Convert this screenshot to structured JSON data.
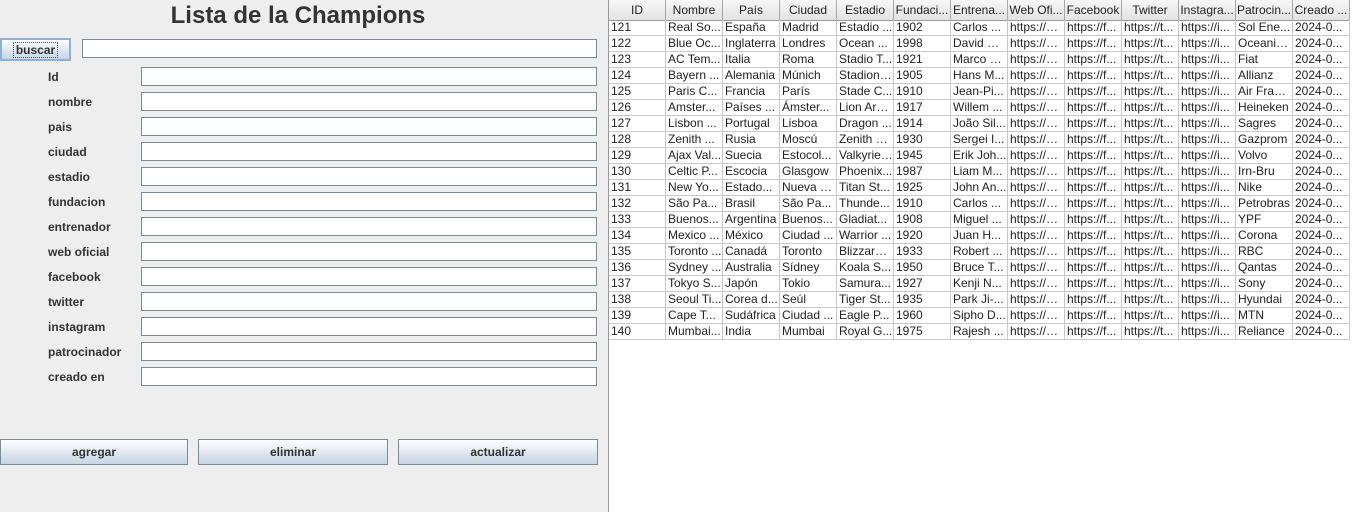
{
  "title": "Lista de la Champions",
  "search": {
    "button_label": "buscar",
    "value": ""
  },
  "fields": [
    {
      "label": "Id",
      "value": ""
    },
    {
      "label": "nombre",
      "value": ""
    },
    {
      "label": "pais",
      "value": ""
    },
    {
      "label": "ciudad",
      "value": ""
    },
    {
      "label": "estadio",
      "value": ""
    },
    {
      "label": "fundacion",
      "value": ""
    },
    {
      "label": "entrenador",
      "value": ""
    },
    {
      "label": "web oficial",
      "value": ""
    },
    {
      "label": "facebook",
      "value": ""
    },
    {
      "label": "twitter",
      "value": ""
    },
    {
      "label": "instagram",
      "value": ""
    },
    {
      "label": "patrocinador",
      "value": ""
    },
    {
      "label": "creado en",
      "value": ""
    }
  ],
  "actions": {
    "add": "agregar",
    "delete": "eliminar",
    "update": "actualizar"
  },
  "table": {
    "columns": [
      "ID",
      "Nombre",
      "País",
      "Ciudad",
      "Estadio",
      "Fundaci...",
      "Entrena...",
      "Web Ofi...",
      "Facebook",
      "Twitter",
      "Instagra...",
      "Patrocin...",
      "Creado ..."
    ],
    "rows": [
      [
        "121",
        "Real So...",
        "España",
        "Madrid",
        "Estadio ...",
        "1902",
        "Carlos ...",
        "https://w...",
        "https://f...",
        "https://t...",
        "https://i...",
        "Sol Ene...",
        "2024-0..."
      ],
      [
        "122",
        "Blue Oc...",
        "Inglaterra",
        "Londres",
        "Ocean ...",
        "1998",
        "David W...",
        "https://w...",
        "https://f...",
        "https://t...",
        "https://i...",
        "Oceanic...",
        "2024-0..."
      ],
      [
        "123",
        "AC Tem...",
        "Italia",
        "Roma",
        "Stadio T...",
        "1921",
        "Marco R...",
        "https://w...",
        "https://f...",
        "https://t...",
        "https://i...",
        "Fiat",
        "2024-0..."
      ],
      [
        "124",
        "Bayern ...",
        "Alemania",
        "Múnich",
        "Stadion ...",
        "1905",
        "Hans M...",
        "https://w...",
        "https://f...",
        "https://t...",
        "https://i...",
        "Allianz",
        "2024-0..."
      ],
      [
        "125",
        "Paris C...",
        "Francia",
        "París",
        "Stade C...",
        "1910",
        "Jean-Pi...",
        "https://w...",
        "https://f...",
        "https://t...",
        "https://i...",
        "Air France",
        "2024-0..."
      ],
      [
        "126",
        "Amster...",
        "Países ...",
        "Ámster...",
        "Lion Are...",
        "1917",
        "Willem ...",
        "https://w...",
        "https://f...",
        "https://t...",
        "https://i...",
        "Heineken",
        "2024-0..."
      ],
      [
        "127",
        "Lisbon ...",
        "Portugal",
        "Lisboa",
        "Dragon ...",
        "1914",
        "João Sil...",
        "https://w...",
        "https://f...",
        "https://t...",
        "https://i...",
        "Sagres",
        "2024-0..."
      ],
      [
        "128",
        "Zenith ...",
        "Rusia",
        "Moscú",
        "Zenith S...",
        "1930",
        "Sergei I...",
        "https://w...",
        "https://f...",
        "https://t...",
        "https://i...",
        "Gazprom",
        "2024-0..."
      ],
      [
        "129",
        "Ajax Val...",
        "Suecia",
        "Estocol...",
        "Valkyrie ...",
        "1945",
        "Erik Joh...",
        "https://w...",
        "https://f...",
        "https://t...",
        "https://i...",
        "Volvo",
        "2024-0..."
      ],
      [
        "130",
        "Celtic P...",
        "Escocia",
        "Glasgow",
        "Phoenix...",
        "1987",
        "Liam M...",
        "https://w...",
        "https://f...",
        "https://t...",
        "https://i...",
        "Irn-Bru",
        "2024-0..."
      ],
      [
        "131",
        "New Yo...",
        "Estado...",
        "Nueva Y...",
        "Titan St...",
        "1925",
        "John An...",
        "https://w...",
        "https://f...",
        "https://t...",
        "https://i...",
        "Nike",
        "2024-0..."
      ],
      [
        "132",
        "São Pa...",
        "Brasil",
        "São Pa...",
        "Thunde...",
        "1910",
        "Carlos ...",
        "https://w...",
        "https://f...",
        "https://t...",
        "https://i...",
        "Petrobras",
        "2024-0..."
      ],
      [
        "133",
        "Buenos...",
        "Argentina",
        "Buenos...",
        "Gladiat...",
        "1908",
        "Miguel ...",
        "https://w...",
        "https://f...",
        "https://t...",
        "https://i...",
        "YPF",
        "2024-0..."
      ],
      [
        "134",
        "Mexico ...",
        "México",
        "Ciudad ...",
        "Warrior ...",
        "1920",
        "Juan H...",
        "https://w...",
        "https://f...",
        "https://t...",
        "https://i...",
        "Corona",
        "2024-0..."
      ],
      [
        "135",
        "Toronto ...",
        "Canadá",
        "Toronto",
        "Blizzard ...",
        "1933",
        "Robert ...",
        "https://w...",
        "https://f...",
        "https://t...",
        "https://i...",
        "RBC",
        "2024-0..."
      ],
      [
        "136",
        "Sydney ...",
        "Australia",
        "Sídney",
        "Koala S...",
        "1950",
        "Bruce T...",
        "https://w...",
        "https://f...",
        "https://t...",
        "https://i...",
        "Qantas",
        "2024-0..."
      ],
      [
        "137",
        "Tokyo S...",
        "Japón",
        "Tokio",
        "Samura...",
        "1927",
        "Kenji N...",
        "https://w...",
        "https://f...",
        "https://t...",
        "https://i...",
        "Sony",
        "2024-0..."
      ],
      [
        "138",
        "Seoul Ti...",
        "Corea d...",
        "Seúl",
        "Tiger St...",
        "1935",
        "Park Ji-...",
        "https://w...",
        "https://f...",
        "https://t...",
        "https://i...",
        "Hyundai",
        "2024-0..."
      ],
      [
        "139",
        "Cape T...",
        "Sudáfrica",
        "Ciudad ...",
        "Eagle P...",
        "1960",
        "Sipho D...",
        "https://w...",
        "https://f...",
        "https://t...",
        "https://i...",
        "MTN",
        "2024-0..."
      ],
      [
        "140",
        "Mumbai...",
        "India",
        "Mumbai",
        "Royal G...",
        "1975",
        "Rajesh ...",
        "https://w...",
        "https://f...",
        "https://t...",
        "https://i...",
        "Reliance",
        "2024-0..."
      ]
    ]
  }
}
